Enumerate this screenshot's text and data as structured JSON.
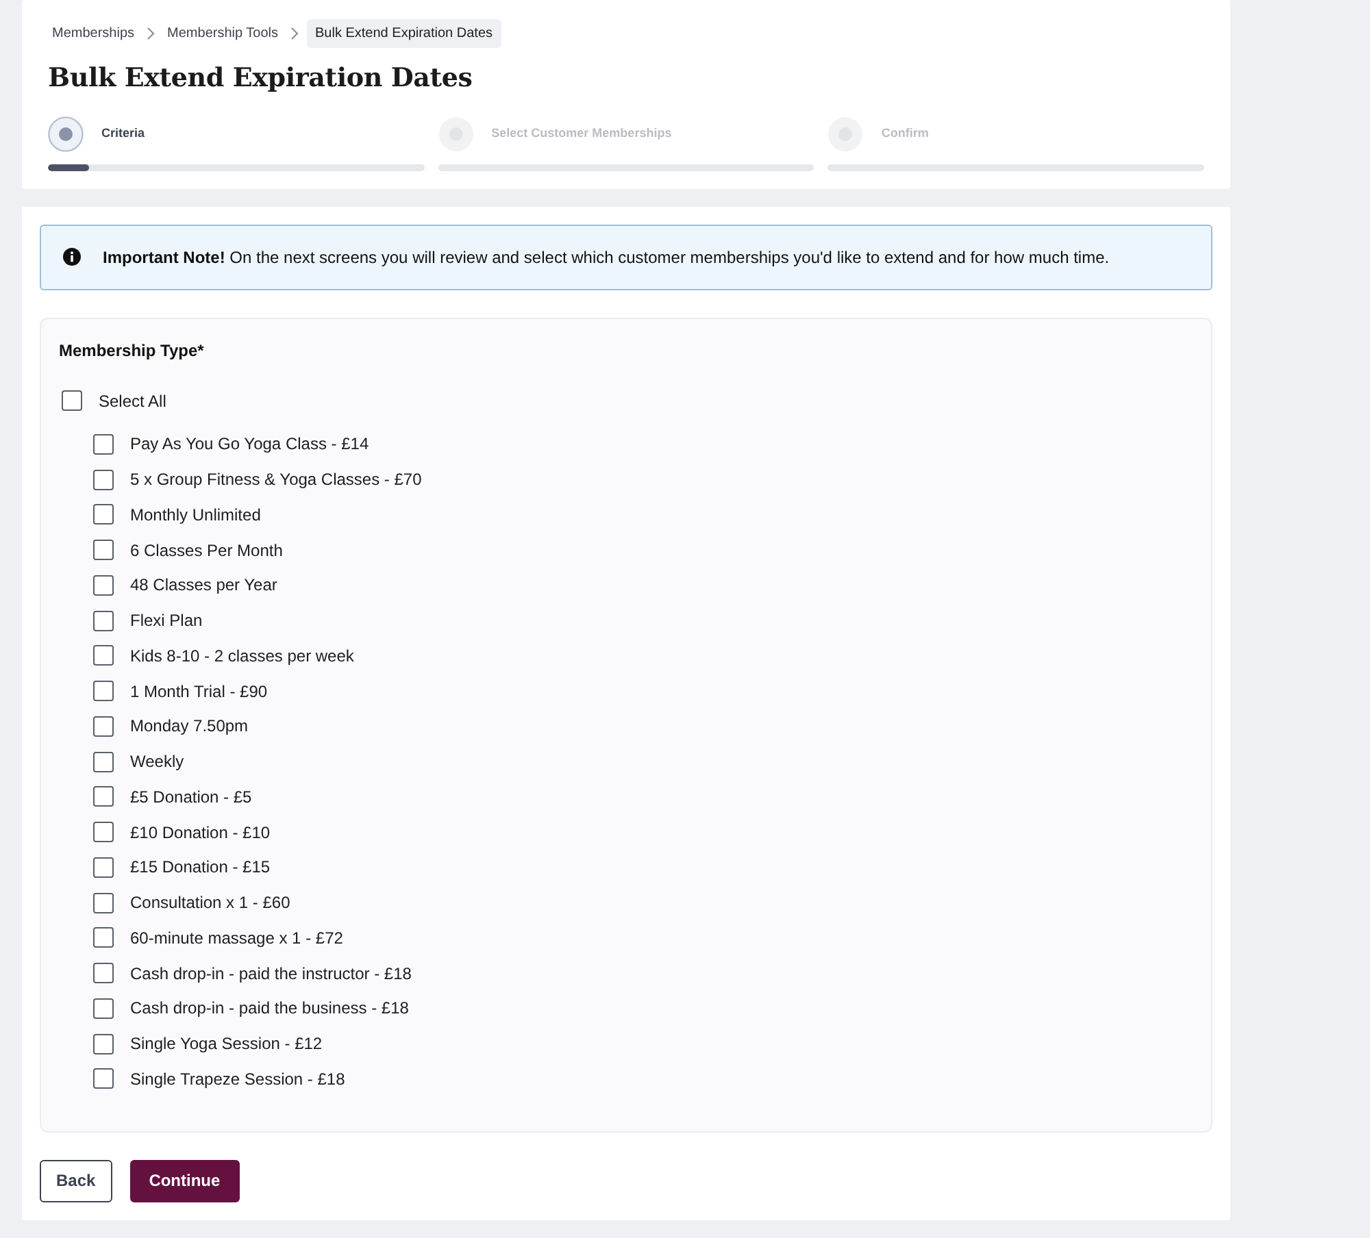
{
  "breadcrumb": [
    {
      "label": "Memberships",
      "current": false
    },
    {
      "label": "Membership Tools",
      "current": false
    },
    {
      "label": "Bulk Extend Expiration Dates",
      "current": true
    }
  ],
  "title": "Bulk Extend Expiration Dates",
  "steps": [
    {
      "label": "Criteria",
      "selected": true,
      "level": 0.11
    },
    {
      "label": "Select Customer Memberships",
      "selected": false,
      "level": 0
    },
    {
      "label": "Confirm",
      "selected": false,
      "level": 0
    }
  ],
  "alert": {
    "text": "**Important Note!** On the next screens you will review and select which customer memberships you'd like to extend and for how much time."
  },
  "membership_type": {
    "label": "Membership Type*",
    "select_all": {
      "label": "Select All",
      "checked": false
    },
    "options": [
      {
        "label": "Pay As You Go Yoga Class - £14",
        "checked": false
      },
      {
        "label": "5 x Group Fitness & Yoga Classes - £70",
        "checked": false
      },
      {
        "label": "Monthly Unlimited",
        "checked": false
      },
      {
        "label": "6 Classes Per Month",
        "checked": false
      },
      {
        "label": "48 Classes per Year",
        "checked": false
      },
      {
        "label": "Flexi Plan",
        "checked": false
      },
      {
        "label": "Kids 8-10 - 2 classes per week",
        "checked": false
      },
      {
        "label": "1 Month Trial - £90",
        "checked": false
      },
      {
        "label": "Monday 7.50pm",
        "checked": false
      },
      {
        "label": "Weekly",
        "checked": false
      },
      {
        "label": "£5 Donation - £5",
        "checked": false
      },
      {
        "label": "£10 Donation - £10",
        "checked": false
      },
      {
        "label": "£15 Donation - £15",
        "checked": false
      },
      {
        "label": "Consultation x 1 - £60",
        "checked": false
      },
      {
        "label": "60-minute massage x 1 - £72",
        "checked": false
      },
      {
        "label": "Cash drop-in - paid the instructor - £18",
        "checked": false
      },
      {
        "label": "Cash drop-in - paid the business - £18",
        "checked": false
      },
      {
        "label": "Single Yoga Session - £12",
        "checked": false
      },
      {
        "label": "Single Trapeze Session - £18",
        "checked": false
      }
    ]
  },
  "buttons": [
    {
      "label": "Back",
      "kind": "outline"
    },
    {
      "label": "Continue",
      "kind": "primary"
    }
  ]
}
